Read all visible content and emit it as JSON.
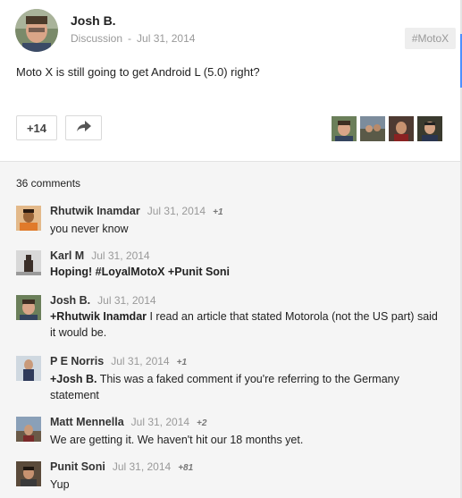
{
  "post": {
    "author": "Josh B.",
    "category": "Discussion",
    "date": "Jul 31, 2014",
    "hashtag": "#MotoX",
    "text": "Moto X is still going to get Android L (5.0) right?",
    "plus_count": "+14"
  },
  "comments_section": {
    "count_label": "36 comments",
    "items": [
      {
        "name": "Rhutwik Inamdar",
        "date": "Jul 31, 2014",
        "plus": "+1",
        "mention": "",
        "text": "you never know"
      },
      {
        "name": "Karl M",
        "date": "Jul 31, 2014",
        "plus": "",
        "mention": "",
        "text": "Hoping! #LoyalMotoX +Punit Soni"
      },
      {
        "name": "Josh B.",
        "date": "Jul 31, 2014",
        "plus": "",
        "mention": "+Rhutwik Inamdar",
        "text": " I read an article that stated Motorola (not the US part) said it would be."
      },
      {
        "name": "P E Norris",
        "date": "Jul 31, 2014",
        "plus": "+1",
        "mention": "+Josh B.",
        "text": " This was a faked comment if you're referring to the Germany statement"
      },
      {
        "name": "Matt Mennella",
        "date": "Jul 31, 2014",
        "plus": "+2",
        "mention": "",
        "text": "We are getting it. We haven't hit our 18 months yet."
      },
      {
        "name": "Punit Soni",
        "date": "Jul 31, 2014",
        "plus": "+81",
        "mention": "",
        "text": "Yup"
      }
    ]
  },
  "colors": {
    "link_blue": "#4d90fe",
    "background_gray": "#f5f5f5"
  },
  "icons": {
    "share": "share-arrow-icon"
  }
}
